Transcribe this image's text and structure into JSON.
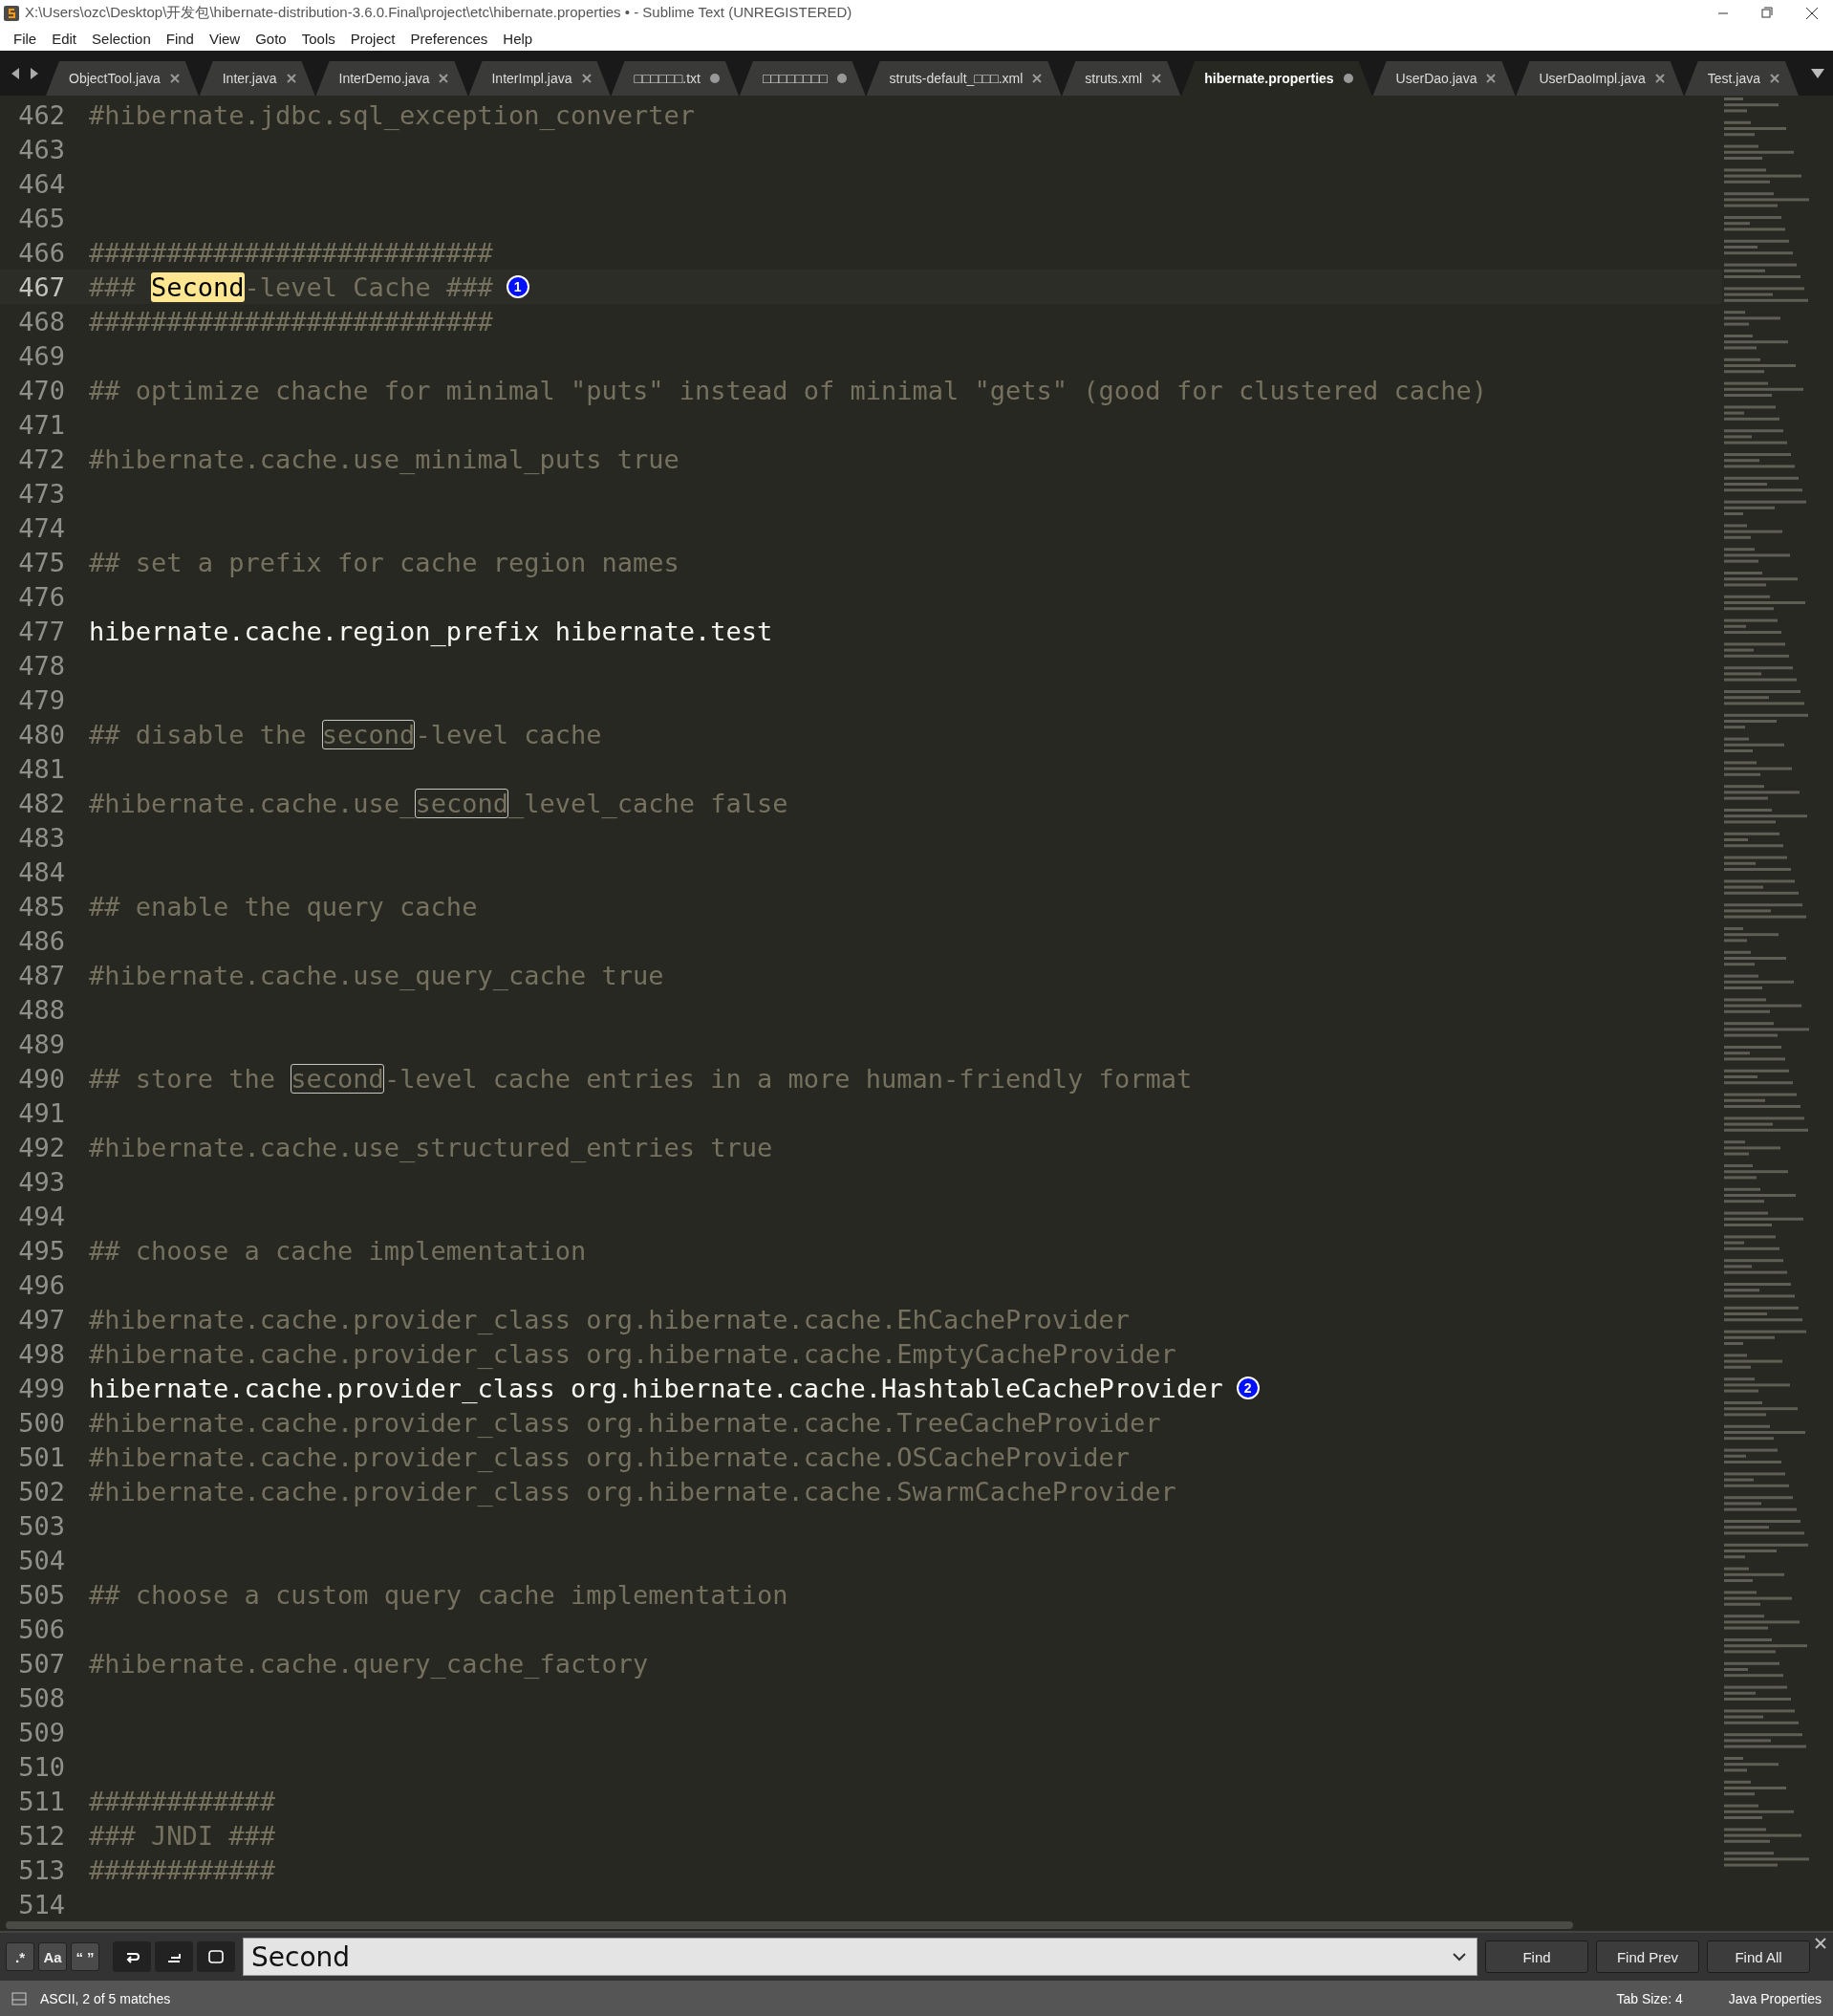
{
  "window": {
    "title": "X:\\Users\\ozc\\Desktop\\开发包\\hibernate-distribution-3.6.0.Final\\project\\etc\\hibernate.properties • - Sublime Text (UNREGISTERED)"
  },
  "menu": [
    "File",
    "Edit",
    "Selection",
    "Find",
    "View",
    "Goto",
    "Tools",
    "Project",
    "Preferences",
    "Help"
  ],
  "tabs": [
    {
      "label": "ObjectTool.java",
      "selected": false,
      "dirty": false
    },
    {
      "label": "Inter.java",
      "selected": false,
      "dirty": false
    },
    {
      "label": "InterDemo.java",
      "selected": false,
      "dirty": false
    },
    {
      "label": "InterImpl.java",
      "selected": false,
      "dirty": false
    },
    {
      "label": "□□□□□□.txt",
      "selected": false,
      "dirty": true
    },
    {
      "label": "□□□□□□□□",
      "selected": false,
      "dirty": true
    },
    {
      "label": "struts-default_□□□.xml",
      "selected": false,
      "dirty": false
    },
    {
      "label": "struts.xml",
      "selected": false,
      "dirty": false
    },
    {
      "label": "hibernate.properties",
      "selected": true,
      "dirty": true
    },
    {
      "label": "UserDao.java",
      "selected": false,
      "dirty": false
    },
    {
      "label": "UserDaoImpl.java",
      "selected": false,
      "dirty": false
    },
    {
      "label": "Test.java",
      "selected": false,
      "dirty": false
    }
  ],
  "editor": {
    "lines": [
      {
        "number": "462",
        "kind": "comment",
        "current": false,
        "parts": [
          {
            "text": "#hibernate.jdbc.sql_exception_converter"
          }
        ]
      },
      {
        "number": "463",
        "kind": "blank",
        "current": false
      },
      {
        "number": "464",
        "kind": "blank",
        "current": false
      },
      {
        "number": "465",
        "kind": "blank",
        "current": false
      },
      {
        "number": "466",
        "kind": "comment",
        "current": false,
        "parts": [
          {
            "text": "##########################"
          }
        ]
      },
      {
        "number": "467",
        "kind": "comment",
        "current": true,
        "badge": "1",
        "parts": [
          {
            "text": "### "
          },
          {
            "text": "Second",
            "match": true,
            "selected": true
          },
          {
            "text": "-level Cache ###"
          }
        ]
      },
      {
        "number": "468",
        "kind": "comment",
        "current": false,
        "parts": [
          {
            "text": "##########################"
          }
        ]
      },
      {
        "number": "469",
        "kind": "blank",
        "current": false
      },
      {
        "number": "470",
        "kind": "comment",
        "current": false,
        "parts": [
          {
            "text": "## optimize chache for minimal \"puts\" instead of minimal \"gets\" (good for clustered cache)"
          }
        ]
      },
      {
        "number": "471",
        "kind": "blank",
        "current": false
      },
      {
        "number": "472",
        "kind": "comment",
        "current": false,
        "parts": [
          {
            "text": "#hibernate.cache.use_minimal_puts true"
          }
        ]
      },
      {
        "number": "473",
        "kind": "blank",
        "current": false
      },
      {
        "number": "474",
        "kind": "blank",
        "current": false
      },
      {
        "number": "475",
        "kind": "comment",
        "current": false,
        "parts": [
          {
            "text": "## set a prefix for cache region names"
          }
        ]
      },
      {
        "number": "476",
        "kind": "blank",
        "current": false
      },
      {
        "number": "477",
        "kind": "setting",
        "current": false,
        "parts": [
          {
            "text": "hibernate.cache.region_prefix hibernate.test"
          }
        ]
      },
      {
        "number": "478",
        "kind": "blank",
        "current": false
      },
      {
        "number": "479",
        "kind": "blank",
        "current": false
      },
      {
        "number": "480",
        "kind": "comment",
        "current": false,
        "parts": [
          {
            "text": "## disable the "
          },
          {
            "text": "second",
            "match": true,
            "selected": false
          },
          {
            "text": "-level cache"
          }
        ]
      },
      {
        "number": "481",
        "kind": "blank",
        "current": false
      },
      {
        "number": "482",
        "kind": "comment",
        "current": false,
        "parts": [
          {
            "text": "#hibernate.cache.use_"
          },
          {
            "text": "second",
            "match": true,
            "selected": false
          },
          {
            "text": "_level_cache false"
          }
        ]
      },
      {
        "number": "483",
        "kind": "blank",
        "current": false
      },
      {
        "number": "484",
        "kind": "blank",
        "current": false
      },
      {
        "number": "485",
        "kind": "comment",
        "current": false,
        "parts": [
          {
            "text": "## enable the query cache"
          }
        ]
      },
      {
        "number": "486",
        "kind": "blank",
        "current": false
      },
      {
        "number": "487",
        "kind": "comment",
        "current": false,
        "parts": [
          {
            "text": "#hibernate.cache.use_query_cache true"
          }
        ]
      },
      {
        "number": "488",
        "kind": "blank",
        "current": false
      },
      {
        "number": "489",
        "kind": "blank",
        "current": false
      },
      {
        "number": "490",
        "kind": "comment",
        "current": false,
        "parts": [
          {
            "text": "## store the "
          },
          {
            "text": "second",
            "match": true,
            "selected": false
          },
          {
            "text": "-level cache entries in a more human-friendly format"
          }
        ]
      },
      {
        "number": "491",
        "kind": "blank",
        "current": false
      },
      {
        "number": "492",
        "kind": "comment",
        "current": false,
        "parts": [
          {
            "text": "#hibernate.cache.use_structured_entries true"
          }
        ]
      },
      {
        "number": "493",
        "kind": "blank",
        "current": false
      },
      {
        "number": "494",
        "kind": "blank",
        "current": false
      },
      {
        "number": "495",
        "kind": "comment",
        "current": false,
        "parts": [
          {
            "text": "## choose a cache implementation"
          }
        ]
      },
      {
        "number": "496",
        "kind": "blank",
        "current": false
      },
      {
        "number": "497",
        "kind": "comment",
        "current": false,
        "parts": [
          {
            "text": "#hibernate.cache.provider_class org.hibernate.cache.EhCacheProvider"
          }
        ]
      },
      {
        "number": "498",
        "kind": "comment",
        "current": false,
        "parts": [
          {
            "text": "#hibernate.cache.provider_class org.hibernate.cache.EmptyCacheProvider"
          }
        ]
      },
      {
        "number": "499",
        "kind": "setting",
        "current": false,
        "badge": "2",
        "parts": [
          {
            "text": "hibernate.cache.provider_class org.hibernate.cache.HashtableCacheProvider"
          }
        ]
      },
      {
        "number": "500",
        "kind": "comment",
        "current": false,
        "parts": [
          {
            "text": "#hibernate.cache.provider_class org.hibernate.cache.TreeCacheProvider"
          }
        ]
      },
      {
        "number": "501",
        "kind": "comment",
        "current": false,
        "parts": [
          {
            "text": "#hibernate.cache.provider_class org.hibernate.cache.OSCacheProvider"
          }
        ]
      },
      {
        "number": "502",
        "kind": "comment",
        "current": false,
        "parts": [
          {
            "text": "#hibernate.cache.provider_class org.hibernate.cache.SwarmCacheProvider"
          }
        ]
      },
      {
        "number": "503",
        "kind": "blank",
        "current": false
      },
      {
        "number": "504",
        "kind": "blank",
        "current": false
      },
      {
        "number": "505",
        "kind": "comment",
        "current": false,
        "parts": [
          {
            "text": "## choose a custom query cache implementation"
          }
        ]
      },
      {
        "number": "506",
        "kind": "blank",
        "current": false
      },
      {
        "number": "507",
        "kind": "comment",
        "current": false,
        "parts": [
          {
            "text": "#hibernate.cache.query_cache_factory"
          }
        ]
      },
      {
        "number": "508",
        "kind": "blank",
        "current": false
      },
      {
        "number": "509",
        "kind": "blank",
        "current": false
      },
      {
        "number": "510",
        "kind": "blank",
        "current": false
      },
      {
        "number": "511",
        "kind": "comment",
        "current": false,
        "parts": [
          {
            "text": "############"
          }
        ]
      },
      {
        "number": "512",
        "kind": "comment",
        "current": false,
        "parts": [
          {
            "text": "### JNDI ###"
          }
        ]
      },
      {
        "number": "513",
        "kind": "comment",
        "current": false,
        "parts": [
          {
            "text": "############"
          }
        ]
      },
      {
        "number": "514",
        "kind": "blank",
        "current": false
      }
    ]
  },
  "find_panel": {
    "options": [
      {
        "label": ".*",
        "on": false
      },
      {
        "label": "Aa",
        "on": false
      },
      {
        "label": "“ ”",
        "on": false
      }
    ],
    "toggles": [
      {
        "kind": "wrap",
        "on": true
      },
      {
        "kind": "in_selection",
        "on": true
      },
      {
        "kind": "highlight",
        "on": true
      }
    ],
    "value": "Second",
    "buttons": [
      "Find",
      "Find Prev",
      "Find All"
    ]
  },
  "status_bar": {
    "message": "ASCII, 2 of 5 matches",
    "tab_size": "Tab Size: 4",
    "syntax": "Java Properties"
  }
}
